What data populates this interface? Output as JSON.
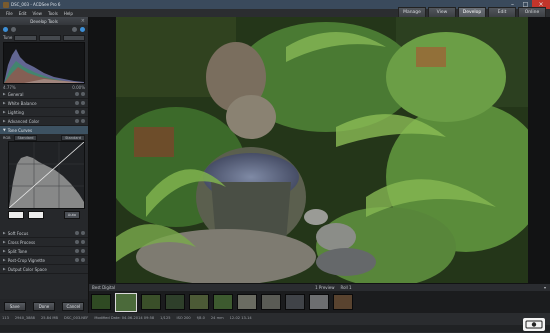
{
  "window": {
    "title": "DSC_003 - ACDSee Pro 6"
  },
  "menu": [
    "File",
    "Edit",
    "View",
    "Tools",
    "Help"
  ],
  "modes": [
    {
      "label": "Manage",
      "active": false
    },
    {
      "label": "View",
      "active": false
    },
    {
      "label": "Develop",
      "active": true
    },
    {
      "label": "Edit",
      "active": false
    },
    {
      "label": "Online",
      "active": false
    }
  ],
  "panel": {
    "title": "Develop Tools",
    "tone_label": "Tune",
    "tone_tabs": [
      "Tune",
      "Detail",
      "Geometry"
    ],
    "histogram_readout_left": "4.77%",
    "histogram_readout_right": "0.00%",
    "sections_top": [
      "General",
      "White Balance",
      "Lighting",
      "Advanced Color"
    ],
    "tone_curves": {
      "label": "Tone Curves",
      "channel_label": "RGB",
      "channel_value": "Standard",
      "mode": "Standard",
      "auto_label": "Auto"
    },
    "sections_bottom": [
      "Soft Focus",
      "Cross Process",
      "Split Tone",
      "Post-Crop Vignette",
      "Output Color Space"
    ],
    "footer": {
      "save": "Save",
      "done": "Done",
      "cancel": "Cancel"
    }
  },
  "filmstrip_header": {
    "left": "Best Digital",
    "mid": "1 Preview",
    "mid2": "Roll 1"
  },
  "thumb_colors": [
    "#2f4a23",
    "#4b6a3a",
    "#3a4f29",
    "#2e3f2a",
    "#4c5a36",
    "#3d5a2f",
    "#6b6c62",
    "#5a5b55",
    "#404348",
    "#6d6e70",
    "#59432f"
  ],
  "status": [
    "113",
    "2940_3888",
    "25.84 MB",
    "DSC_003.NEF",
    "Modified Date: 04-06-2014 09:58",
    "1/125",
    "ISO 200",
    "f/8.0",
    "24 mm",
    "12-02 13-14"
  ],
  "logo_text": "",
  "colors": {
    "accent": "#3d8fd6",
    "titlebar": "#3a4a5c",
    "panel": "#26282b"
  }
}
